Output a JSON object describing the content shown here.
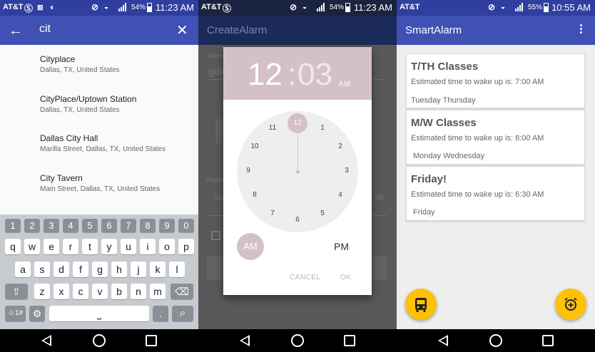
{
  "panel1": {
    "status": {
      "carrier": "AT&T",
      "battery": "54%",
      "time": "11:23 AM"
    },
    "search": {
      "back_icon": "arrow-left-icon",
      "query": "cit",
      "clear_icon": "close-icon"
    },
    "results": [
      {
        "name": "Cityplace",
        "address": "Dallas, TX, United States"
      },
      {
        "name": "CityPlace/Uptown Station",
        "address": "Dallas, TX, United States"
      },
      {
        "name": "Dallas City Hall",
        "address": "Marilla Street, Dallas, TX, United States"
      },
      {
        "name": "City Tavern",
        "address": "Main Street, Dallas, TX, United States"
      }
    ],
    "keyboard": {
      "numbers": [
        "1",
        "2",
        "3",
        "4",
        "5",
        "6",
        "7",
        "8",
        "9",
        "0"
      ],
      "row1": [
        "q",
        "w",
        "e",
        "r",
        "t",
        "y",
        "u",
        "i",
        "o",
        "p"
      ],
      "row2": [
        "a",
        "s",
        "d",
        "f",
        "g",
        "h",
        "j",
        "k",
        "l"
      ],
      "row3": [
        "z",
        "x",
        "c",
        "v",
        "b",
        "n",
        "m"
      ],
      "sym_label": "☺1#",
      "period": ".",
      "space": "⎵"
    }
  },
  "panel2": {
    "status": {
      "carrier": "AT&T",
      "battery": "54%",
      "time": "11:23 AM"
    },
    "title": "CreateAlarm",
    "background_text": {
      "field_value": "gdk",
      "day_left": "Su",
      "day_right": "Sa",
      "field_label": "Alarm",
      "repeat_label": "Repeat"
    },
    "dialog": {
      "hour": "12",
      "colon": ":",
      "minute": "03",
      "ampm": "AM",
      "selected_hour": "12",
      "clock_numbers": [
        "12",
        "1",
        "2",
        "3",
        "4",
        "5",
        "6",
        "7",
        "8",
        "9",
        "10",
        "11"
      ],
      "am_label": "AM",
      "pm_label": "PM",
      "cancel_label": "CANCEL",
      "ok_label": "OK"
    }
  },
  "panel3": {
    "status": {
      "carrier": "AT&T",
      "battery": "55%",
      "time": "10:55 AM"
    },
    "title": "SmartAlarm",
    "menu_icon": "more-vert-icon",
    "alarms": [
      {
        "title": "T/TH Classes",
        "estimate": "Estimated time to wake up is: 7:00 AM",
        "days": "Tuesday Thursday"
      },
      {
        "title": "M/W Classes",
        "estimate": "Estimated time to wake up is: 8:00 AM",
        "days": "Monday Wednesday"
      },
      {
        "title": "Friday!",
        "estimate": "Estimated time to wake up is: 6:30 AM",
        "days": "Friday"
      }
    ],
    "fab_left_icon": "bus-icon",
    "fab_right_icon": "add-alarm-icon",
    "colors": {
      "primary": "#3f51b5",
      "primary_dark": "#303f9f",
      "fab": "#ffc107",
      "accent_dialog": "#d4c1c5"
    }
  }
}
